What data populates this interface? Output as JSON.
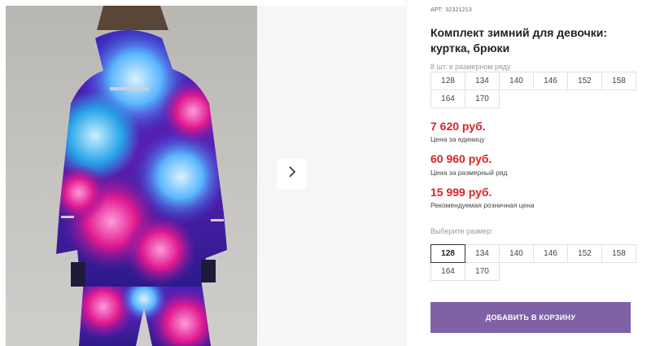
{
  "product": {
    "sku_label": "АРТ:",
    "sku_value": "32321213",
    "title": "Комплект зимний для девочки: куртка, брюки",
    "row_size_label": "8 шт. в размерном ряду",
    "row_sizes": [
      "128",
      "134",
      "140",
      "146",
      "152",
      "158",
      "164",
      "170"
    ]
  },
  "prices": {
    "unit_price": "7 620 руб.",
    "unit_note": "Цена за единицу",
    "row_price": "60 960 руб.",
    "row_note": "Цена за размерный ряд",
    "retail_price": "15 999 руб.",
    "retail_note": "Рекомендуемая розничная цена"
  },
  "size_select": {
    "label": "Выберите размер:",
    "options": [
      "128",
      "134",
      "140",
      "146",
      "152",
      "158",
      "164",
      "170"
    ],
    "selected": "128"
  },
  "cart": {
    "add_label": "Добавить в корзину"
  },
  "gallery": {
    "next_icon": "chevron-right-icon"
  },
  "colors": {
    "price_red": "#d8232a",
    "button_purple": "#7f62a6"
  }
}
